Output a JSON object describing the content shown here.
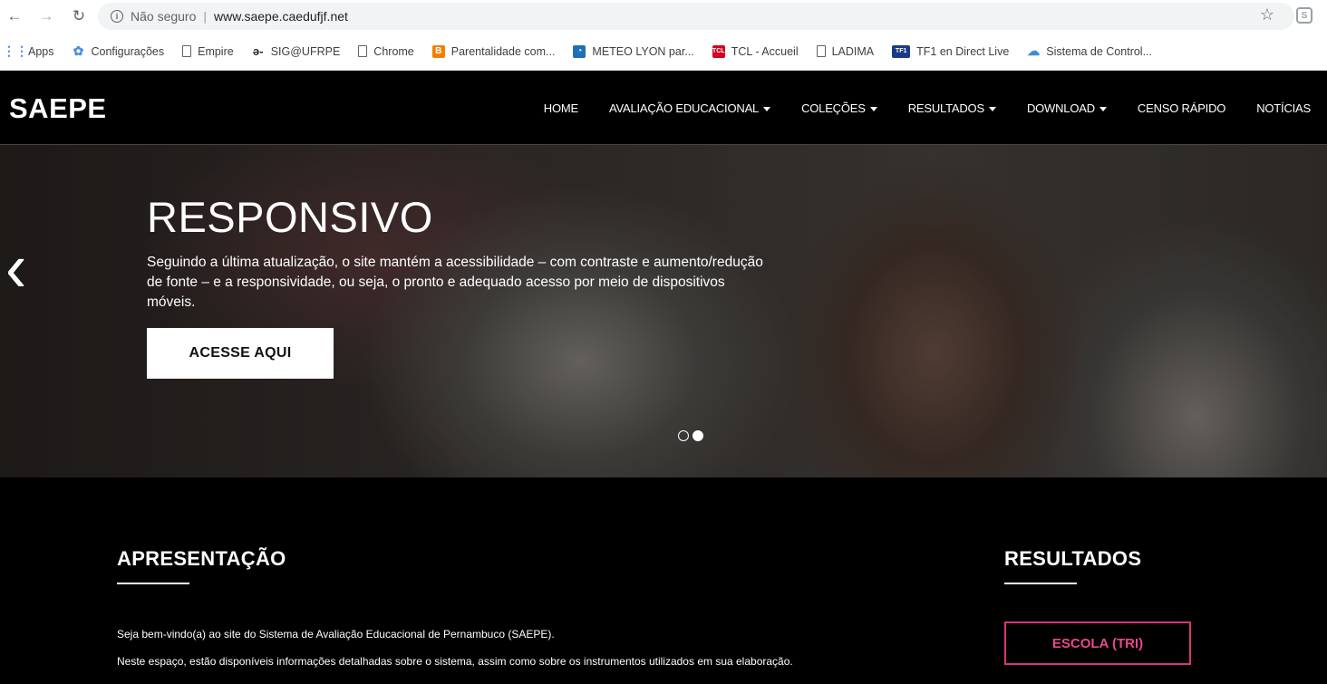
{
  "browser": {
    "security_label": "Não seguro",
    "url_host": "www.saepe.caedufjf.net",
    "bookmarks": [
      {
        "label": "Apps",
        "icon": "apps-grid-icon"
      },
      {
        "label": "Configurações",
        "icon": "gear-icon"
      },
      {
        "label": "Empire",
        "icon": "page-icon"
      },
      {
        "label": "SIG@UFRPE",
        "icon": "sig-icon"
      },
      {
        "label": "Chrome",
        "icon": "page-icon"
      },
      {
        "label": "Parentalidade com...",
        "icon": "blogger-icon"
      },
      {
        "label": "METEO LYON par...",
        "icon": "meteo-icon"
      },
      {
        "label": "TCL - Accueil",
        "icon": "tcl-icon"
      },
      {
        "label": "LADIMA",
        "icon": "page-icon"
      },
      {
        "label": "TF1 en Direct Live",
        "icon": "tf1-icon"
      },
      {
        "label": "Sistema de Control...",
        "icon": "cloud-icon"
      }
    ]
  },
  "site": {
    "logo": "SAEPE",
    "menu": [
      {
        "label": "HOME",
        "dropdown": false
      },
      {
        "label": "AVALIAÇÃO EDUCACIONAL",
        "dropdown": true
      },
      {
        "label": "COLEÇÕES",
        "dropdown": true
      },
      {
        "label": "RESULTADOS",
        "dropdown": true
      },
      {
        "label": "DOWNLOAD",
        "dropdown": true
      },
      {
        "label": "CENSO RÁPIDO",
        "dropdown": false
      },
      {
        "label": "NOTÍCIAS",
        "dropdown": false
      }
    ]
  },
  "hero": {
    "title": "RESPONSIVO",
    "text": "Seguindo a última atualização, o site mantém a acessibilidade – com contraste e aumento/redução de fonte – e a responsividade, ou seja,  o pronto e adequado acesso por meio de dispositivos móveis.",
    "button_label": "ACESSE AQUI",
    "slide_count": 2,
    "active_slide": 2
  },
  "apresentacao": {
    "title": "APRESENTAÇÃO",
    "paragraph1": "Seja bem-vindo(a) ao site do Sistema de Avaliação Educacional de Pernambuco (SAEPE).",
    "paragraph2": "Neste espaço, estão disponíveis informações detalhadas sobre o sistema, assim como sobre  os instrumentos utilizados em sua elaboração."
  },
  "resultados": {
    "title": "RESULTADOS",
    "button_label": "ESCOLA (TRI)"
  },
  "colors": {
    "background": "#000000",
    "accent_pink": "#d9357a"
  }
}
